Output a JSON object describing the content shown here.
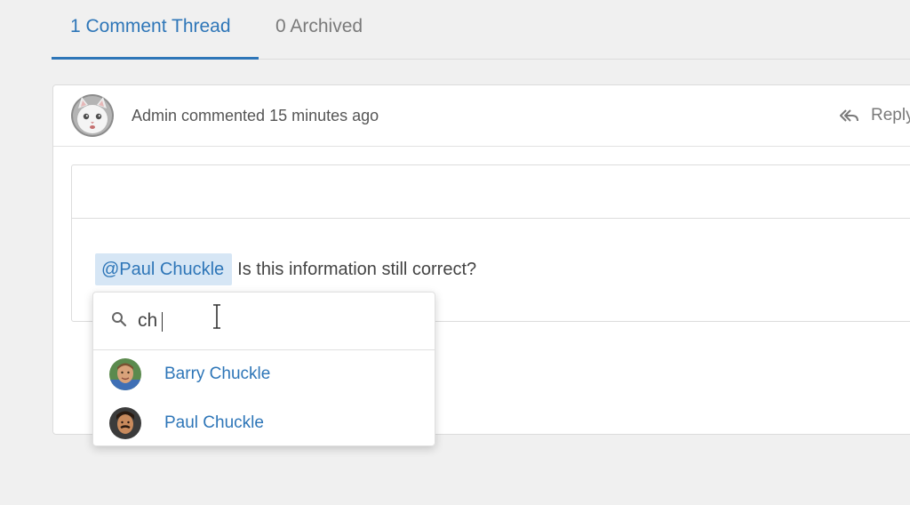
{
  "tabs": [
    {
      "label": "1 Comment Thread",
      "active": true
    },
    {
      "label": "0 Archived",
      "active": false
    }
  ],
  "thread": {
    "avatar_icon": "cat-avatar",
    "meta": "Admin commented 15 minutes ago",
    "reply_icon": "reply-all-icon",
    "reply_label": "Reply"
  },
  "editor": {
    "mention": "@Paul Chuckle",
    "text": "Is this information still correct?"
  },
  "mention_dropdown": {
    "search_icon": "search-icon",
    "search_value": "ch",
    "options": [
      {
        "name": "Barry Chuckle",
        "avatar_icon": "user-avatar"
      },
      {
        "name": "Paul Chuckle",
        "avatar_icon": "user-avatar"
      }
    ]
  },
  "colors": {
    "accent": "#2e76b8",
    "mention_bg": "#d6e6f5",
    "page_bg": "#f0f0f0",
    "border": "#dcdcdc"
  }
}
